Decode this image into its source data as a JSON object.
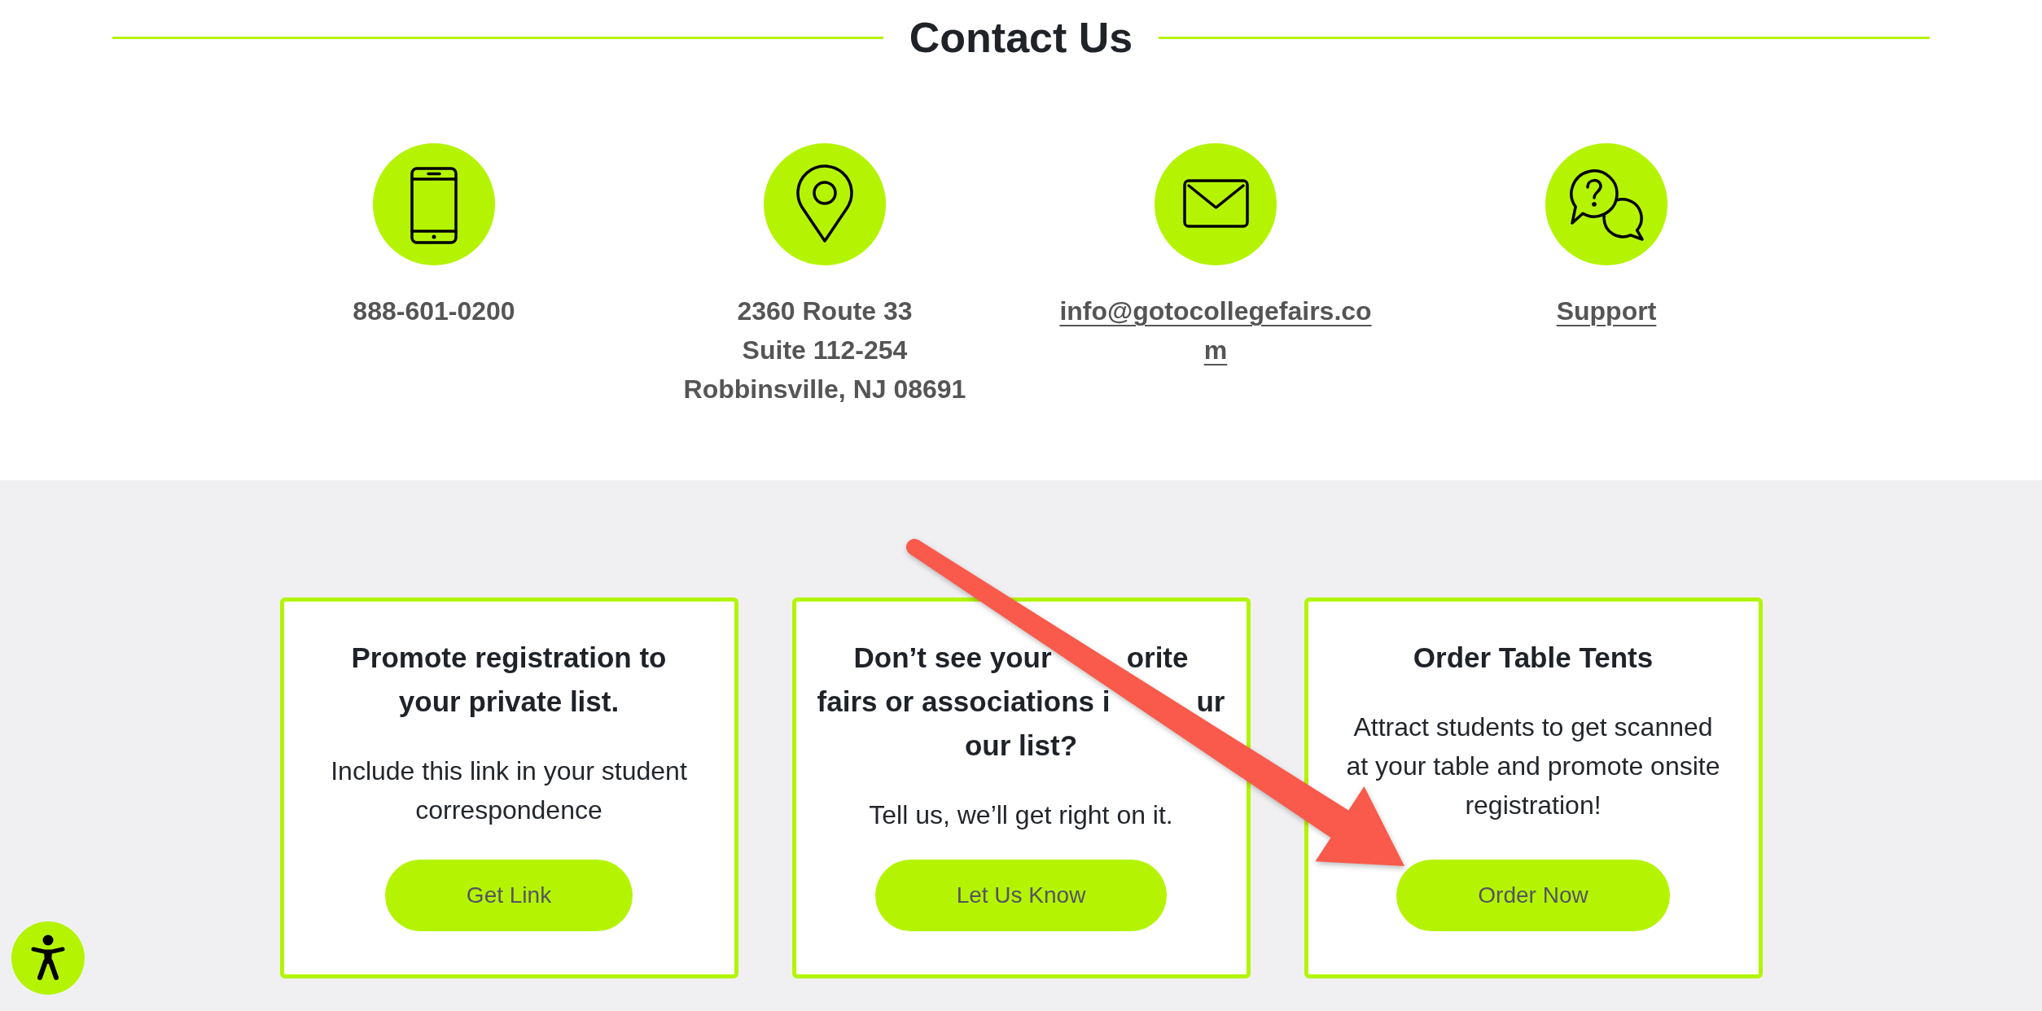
{
  "heading": "Contact Us",
  "contacts": [
    {
      "kind": "phone",
      "lines": [
        "888-601-0200"
      ],
      "link": false
    },
    {
      "kind": "address",
      "lines": [
        "2360 Route 33",
        "Suite 112-254",
        "Robbinsville, NJ 08691"
      ],
      "link": false
    },
    {
      "kind": "email",
      "lines": [
        "info@gotocollegefairs.com"
      ],
      "link": true
    },
    {
      "kind": "support",
      "lines": [
        "Support"
      ],
      "link": true
    }
  ],
  "cards": [
    {
      "kind": "plain",
      "title": "Promote registration to your private list.",
      "text": "Include this link in your student correspondence",
      "button": "Get Link"
    },
    {
      "kind": "partly_covered",
      "title_lines": [
        [
          "Don’t see your",
          "orite"
        ],
        [
          "fairs or associations i",
          "ur"
        ],
        [
          "our list?"
        ]
      ],
      "text": "Tell us, we’ll get right on it.",
      "button": "Let Us Know"
    },
    {
      "kind": "plain",
      "title": "Order Table Tents",
      "text": "Attract students to get scanned at your table and promote onsite registration!",
      "button": "Order Now"
    }
  ]
}
